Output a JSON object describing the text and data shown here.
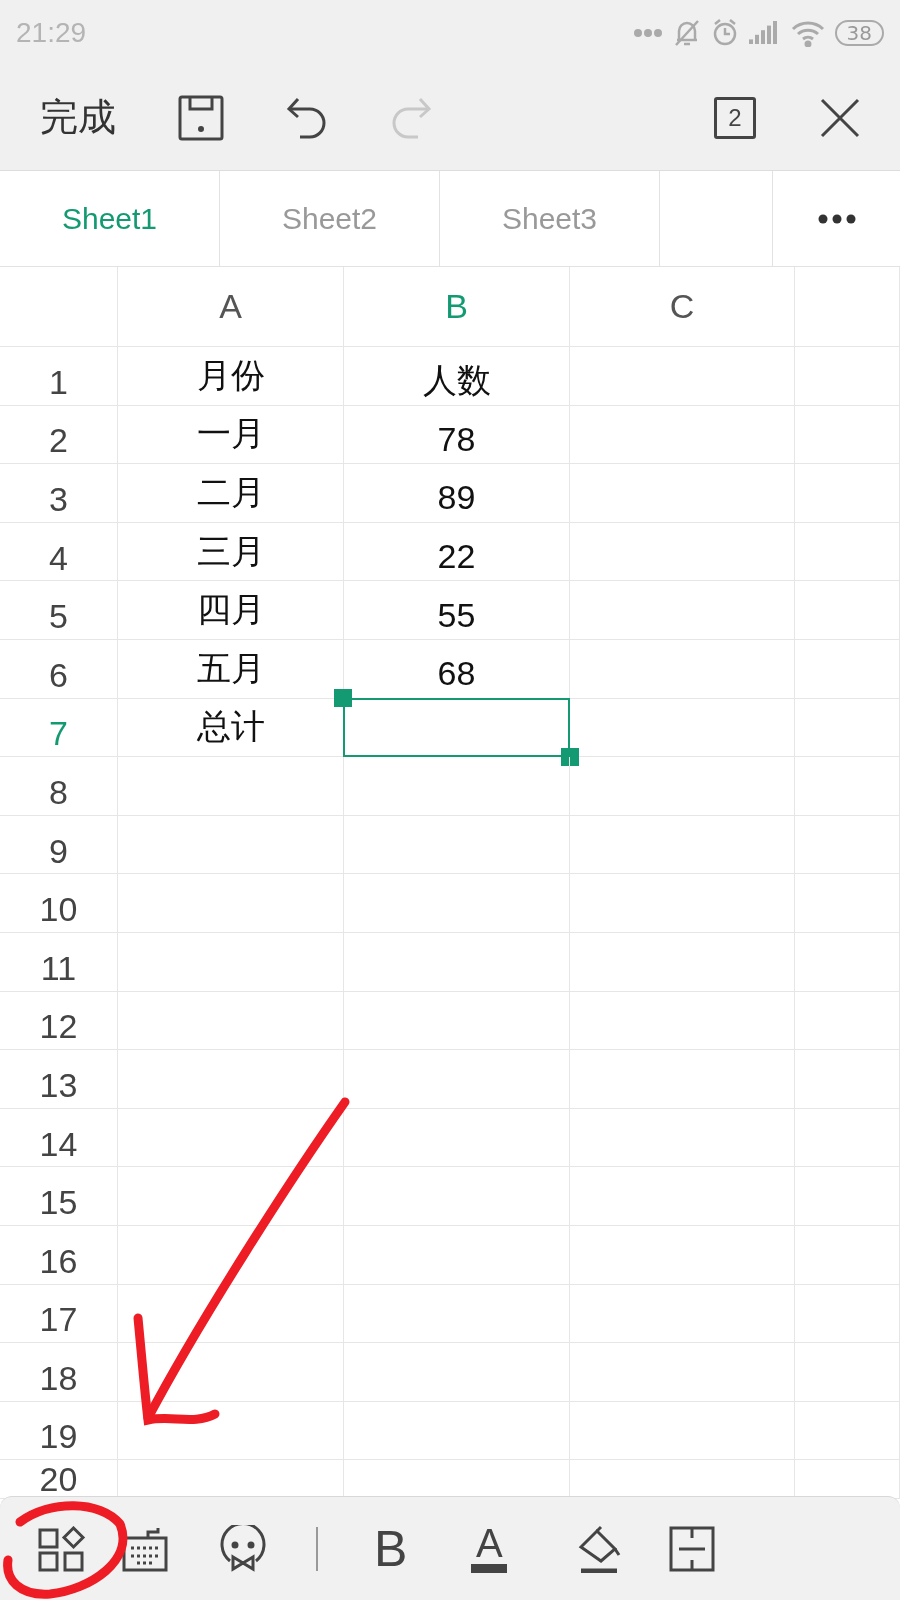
{
  "status_bar": {
    "time": "21:29",
    "battery": "38"
  },
  "toolbar": {
    "done": "完成",
    "window_count": "2",
    "redo_disabled": true
  },
  "sheet_tabs": [
    {
      "label": "Sheet1",
      "selected": true
    },
    {
      "label": "Sheet2",
      "selected": false
    },
    {
      "label": "Sheet3",
      "selected": false
    }
  ],
  "columns": [
    {
      "label": "A",
      "selected": false
    },
    {
      "label": "B",
      "selected": true
    },
    {
      "label": "C",
      "selected": false
    }
  ],
  "rows": [
    {
      "number": "1",
      "selected": false,
      "cells": [
        "月份",
        "人数"
      ]
    },
    {
      "number": "2",
      "selected": false,
      "cells": [
        "一月",
        "78"
      ]
    },
    {
      "number": "3",
      "selected": false,
      "cells": [
        "二月",
        "89"
      ]
    },
    {
      "number": "4",
      "selected": false,
      "cells": [
        "三月",
        "22"
      ]
    },
    {
      "number": "5",
      "selected": false,
      "cells": [
        "四月",
        "55"
      ]
    },
    {
      "number": "6",
      "selected": false,
      "cells": [
        "五月",
        "68"
      ]
    },
    {
      "number": "7",
      "selected": true,
      "cells": [
        "总计",
        ""
      ]
    },
    {
      "number": "8",
      "selected": false,
      "cells": []
    },
    {
      "number": "9",
      "selected": false,
      "cells": []
    },
    {
      "number": "10",
      "selected": false,
      "cells": []
    },
    {
      "number": "11",
      "selected": false,
      "cells": []
    },
    {
      "number": "12",
      "selected": false,
      "cells": []
    },
    {
      "number": "13",
      "selected": false,
      "cells": []
    },
    {
      "number": "14",
      "selected": false,
      "cells": []
    },
    {
      "number": "15",
      "selected": false,
      "cells": []
    },
    {
      "number": "16",
      "selected": false,
      "cells": []
    },
    {
      "number": "17",
      "selected": false,
      "cells": []
    },
    {
      "number": "18",
      "selected": false,
      "cells": []
    },
    {
      "number": "19",
      "selected": false,
      "cells": []
    },
    {
      "number": "20",
      "selected": false,
      "cells": []
    }
  ],
  "bottom_toolbar": {
    "bold": "B",
    "font_color": "A"
  }
}
